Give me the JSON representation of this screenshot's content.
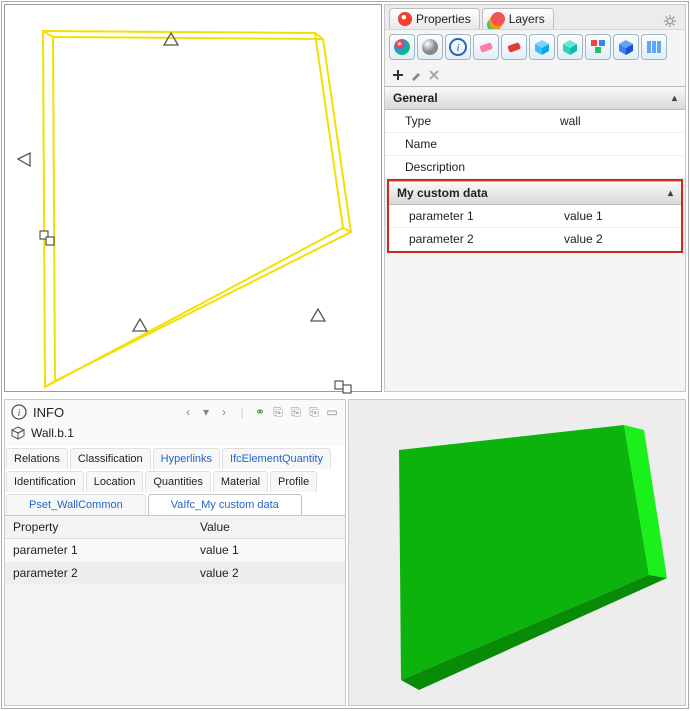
{
  "side": {
    "tabs": {
      "properties": "Properties",
      "layers": "Layers"
    },
    "sections": {
      "general": {
        "title": "General",
        "rows": [
          {
            "k": "Type",
            "v": "wall"
          },
          {
            "k": "Name",
            "v": ""
          },
          {
            "k": "Description",
            "v": ""
          }
        ]
      },
      "custom": {
        "title": "My custom data",
        "rows": [
          {
            "k": "parameter 1",
            "v": "value 1"
          },
          {
            "k": "parameter 2",
            "v": "value 2"
          }
        ]
      }
    }
  },
  "info": {
    "title": "INFO",
    "object": "Wall.b.1",
    "tabs_row1": [
      "Relations",
      "Classification",
      "Hyperlinks",
      "IfcElementQuantity"
    ],
    "tabs_link1": [
      false,
      false,
      true,
      true
    ],
    "tabs_row2": [
      "Identification",
      "Location",
      "Quantities",
      "Material",
      "Profile"
    ],
    "tabs_row3": [
      "Pset_WallCommon",
      "VaIfc_My custom data"
    ],
    "tabs_link3": [
      true,
      true
    ],
    "table": {
      "headers": [
        "Property",
        "Value"
      ],
      "rows": [
        {
          "p": "parameter 1",
          "v": "value 1"
        },
        {
          "p": "parameter 2",
          "v": "value 2"
        }
      ]
    }
  },
  "toolbar_icons": [
    "color-sphere",
    "grey-sphere",
    "info-circle",
    "eraser-pink",
    "eraser-red",
    "cube-blue",
    "cube-teal",
    "cubes-multi",
    "cube-solid",
    "columns"
  ]
}
